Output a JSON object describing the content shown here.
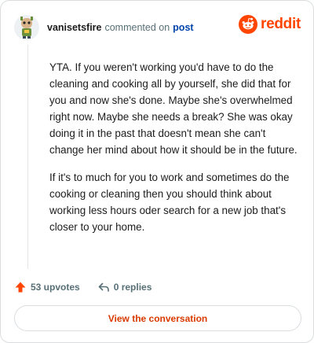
{
  "comment": {
    "username": "vanisetsfire",
    "action_text": "commented on",
    "post_link": "post",
    "paragraphs": [
      "YTA. If you weren't working you'd have to do the cleaning and cooking all by yourself, she did that for you and now she's done. Maybe she's overwhelmed right now. Maybe she needs a break? She was okay doing it in the past that doesn't mean she can't change her mind about how it should be in the future.",
      "If it's to much for you to work and sometimes do the cooking or cleaning then you should think about working less hours oder search for a new job that's closer to your home."
    ],
    "upvotes": "53 upvotes",
    "replies": "0 replies"
  },
  "brand": {
    "name": "reddit",
    "color": "#ff4500"
  },
  "cta": {
    "label": "View the conversation"
  },
  "icons": {
    "upvote": "arrow-up-icon",
    "reply": "reply-arrow-icon",
    "brand": "reddit-snoo-icon"
  }
}
